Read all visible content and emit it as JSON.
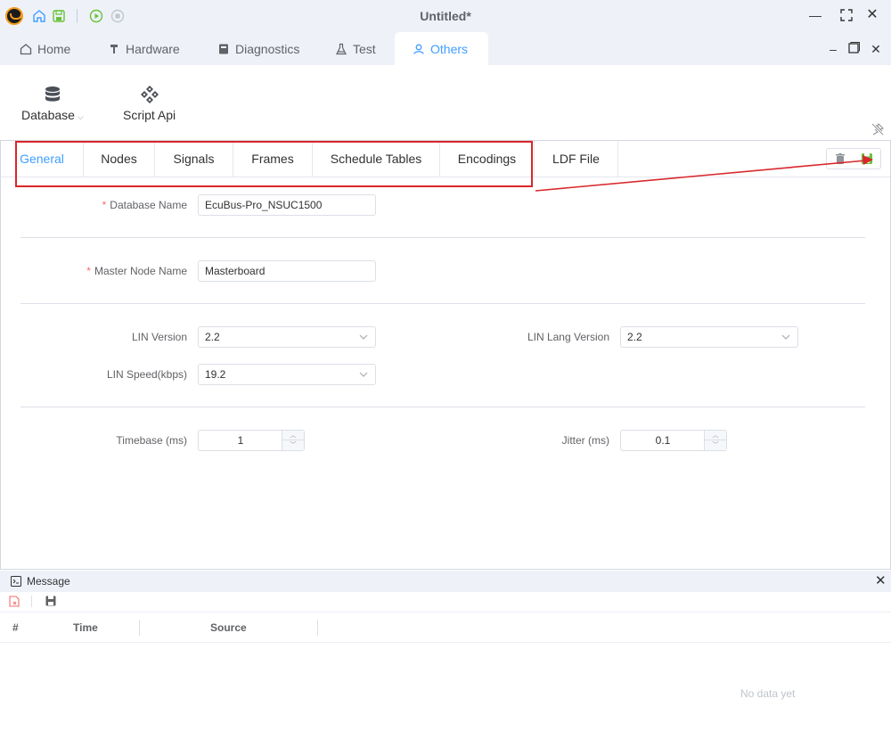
{
  "window": {
    "title": "Untitled*",
    "icons": [
      "app-logo-icon",
      "home-icon",
      "save-icon",
      "play-icon",
      "stop-icon",
      "minimize-icon",
      "maximize-icon",
      "close-icon"
    ]
  },
  "main_tabs": [
    {
      "label": "Home",
      "icon": "home-icon"
    },
    {
      "label": "Hardware",
      "icon": "hardware-icon"
    },
    {
      "label": "Diagnostics",
      "icon": "diagnostics-icon"
    },
    {
      "label": "Test",
      "icon": "flask-icon"
    },
    {
      "label": "Others",
      "icon": "user-icon",
      "active": true
    }
  ],
  "ribbon": {
    "database_label": "Database",
    "script_api_label": "Script Api"
  },
  "sub_tabs": [
    {
      "label": "General",
      "active": true
    },
    {
      "label": "Nodes"
    },
    {
      "label": "Signals"
    },
    {
      "label": "Frames"
    },
    {
      "label": "Schedule Tables"
    },
    {
      "label": "Encodings"
    },
    {
      "label": "LDF File"
    }
  ],
  "form": {
    "database_name": {
      "label": "Database Name",
      "value": "EcuBus-Pro_NSUC1500"
    },
    "master_node_name": {
      "label": "Master Node Name",
      "value": "Masterboard"
    },
    "lin_version": {
      "label": "LIN Version",
      "value": "2.2"
    },
    "lin_lang_version": {
      "label": "LIN Lang Version",
      "value": "2.2"
    },
    "lin_speed": {
      "label": "LIN Speed(kbps)",
      "value": "19.2"
    },
    "timebase": {
      "label": "Timebase (ms)",
      "value": "1"
    },
    "jitter": {
      "label": "Jitter (ms)",
      "value": "0.1"
    },
    "required_mark": "*"
  },
  "message": {
    "title": "Message",
    "columns": [
      "#",
      "Time",
      "Source"
    ],
    "empty_text": "No data yet"
  },
  "colors": {
    "accent": "#409eff",
    "annotation_red": "#d9262b",
    "save_green": "#67c23a"
  }
}
